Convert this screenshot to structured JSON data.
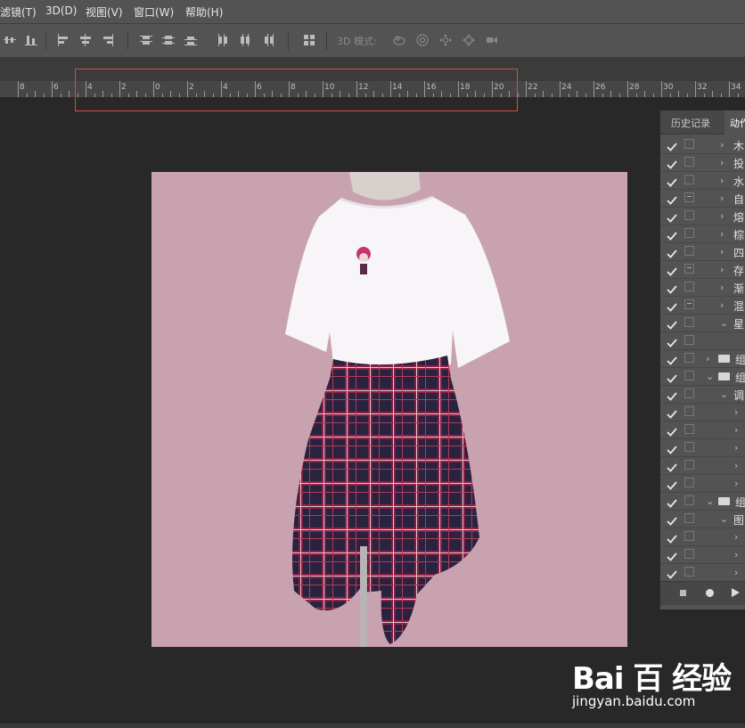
{
  "menu": [
    "滤镜(T)",
    "3D(D)",
    "视图(V)",
    "窗口(W)",
    "帮助(H)"
  ],
  "optionsbar": {
    "mode_label": "3D 模式:"
  },
  "ruler": {
    "labels": [
      "8",
      "6",
      "4",
      "2",
      "0",
      "2",
      "4",
      "6",
      "8",
      "10",
      "12",
      "14",
      "16",
      "18",
      "20",
      "22",
      "24",
      "26",
      "28",
      "30",
      "32",
      "34"
    ]
  },
  "panel": {
    "tabs": [
      "历史记录",
      "动作"
    ],
    "rows": [
      {
        "check": true,
        "box": "",
        "indent": 0,
        "arrow": "›",
        "folder": false,
        "label": "木"
      },
      {
        "check": true,
        "box": "",
        "indent": 0,
        "arrow": "›",
        "folder": false,
        "label": "投"
      },
      {
        "check": true,
        "box": "",
        "indent": 0,
        "arrow": "›",
        "folder": false,
        "label": "水"
      },
      {
        "check": true,
        "box": "dlg",
        "indent": 0,
        "arrow": "›",
        "folder": false,
        "label": "自"
      },
      {
        "check": true,
        "box": "",
        "indent": 0,
        "arrow": "›",
        "folder": false,
        "label": "熔"
      },
      {
        "check": true,
        "box": "",
        "indent": 0,
        "arrow": "›",
        "folder": false,
        "label": "棕"
      },
      {
        "check": true,
        "box": "",
        "indent": 0,
        "arrow": "›",
        "folder": false,
        "label": "四"
      },
      {
        "check": true,
        "box": "dlg",
        "indent": 0,
        "arrow": "›",
        "folder": false,
        "label": "存"
      },
      {
        "check": true,
        "box": "",
        "indent": 0,
        "arrow": "›",
        "folder": false,
        "label": "渐"
      },
      {
        "check": true,
        "box": "dlg",
        "indent": 0,
        "arrow": "›",
        "folder": false,
        "label": "混"
      },
      {
        "check": true,
        "box": "",
        "indent": 0,
        "arrow": "⌄",
        "folder": false,
        "label": "星"
      },
      {
        "check": true,
        "box": "",
        "indent": 0,
        "arrow": "",
        "folder": false,
        "label": ""
      },
      {
        "check": true,
        "box": "",
        "indent": -1,
        "arrow": "›",
        "folder": true,
        "label": "组"
      },
      {
        "check": true,
        "box": "",
        "indent": -1,
        "arrow": "⌄",
        "folder": true,
        "label": "组"
      },
      {
        "check": true,
        "box": "",
        "indent": 0,
        "arrow": "⌄",
        "folder": false,
        "label": "调"
      },
      {
        "check": true,
        "box": "",
        "indent": 1,
        "arrow": "›",
        "folder": false,
        "label": ""
      },
      {
        "check": true,
        "box": "",
        "indent": 1,
        "arrow": "›",
        "folder": false,
        "label": ""
      },
      {
        "check": true,
        "box": "",
        "indent": 1,
        "arrow": "›",
        "folder": false,
        "label": ""
      },
      {
        "check": true,
        "box": "",
        "indent": 1,
        "arrow": "›",
        "folder": false,
        "label": ""
      },
      {
        "check": true,
        "box": "",
        "indent": 1,
        "arrow": "›",
        "folder": false,
        "label": ""
      },
      {
        "check": true,
        "box": "",
        "indent": -1,
        "arrow": "⌄",
        "folder": true,
        "label": "组"
      },
      {
        "check": true,
        "box": "",
        "indent": 0,
        "arrow": "⌄",
        "folder": false,
        "label": "图"
      },
      {
        "check": true,
        "box": "",
        "indent": 1,
        "arrow": "›",
        "folder": false,
        "label": ""
      },
      {
        "check": true,
        "box": "",
        "indent": 1,
        "arrow": "›",
        "folder": false,
        "label": ""
      },
      {
        "check": true,
        "box": "",
        "indent": 1,
        "arrow": "›",
        "folder": false,
        "label": ""
      }
    ]
  },
  "watermark": {
    "logo": "Bai 百 经验",
    "url": "jingyan.baidu.com"
  },
  "colors": {
    "accent_highlight": "#e04a3a",
    "photo_background": "#c9a2b0"
  }
}
